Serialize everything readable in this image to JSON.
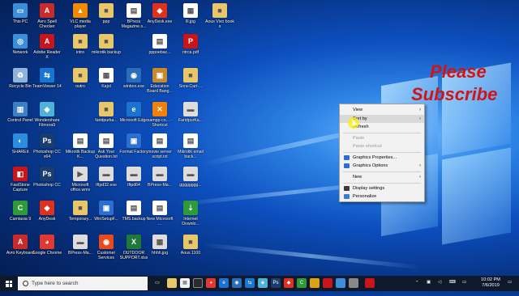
{
  "overlay": {
    "line1": "Please",
    "line2": "Subscribe"
  },
  "desktop": {
    "icons": [
      {
        "label": "This PC",
        "color": "#3a8fd8",
        "glyph": "▭"
      },
      {
        "label": "Avro Spell Checker",
        "color": "#c92b2b",
        "glyph": "A"
      },
      {
        "label": "VLC media player",
        "color": "#f08a00",
        "glyph": "▲"
      },
      {
        "label": "ppp",
        "color": "#e8c76a",
        "glyph": "■"
      },
      {
        "label": "BPress Magazine.s...",
        "color": "#ffffff",
        "glyph": "▤"
      },
      {
        "label": "AnyDesk.exe",
        "color": "#e0311f",
        "glyph": "◆"
      },
      {
        "label": "lll.jpg",
        "color": "#ffffff",
        "glyph": "▦"
      },
      {
        "label": "Aous Vivo book s",
        "color": "#e8c76a",
        "glyph": "■"
      },
      {
        "label": "Network",
        "color": "#3a8fd8",
        "glyph": "◎"
      },
      {
        "label": "Adobe Reader X",
        "color": "#c8151b",
        "glyph": "A"
      },
      {
        "label": "intro",
        "color": "#e8c76a",
        "glyph": "■"
      },
      {
        "label": "mikrotik backup",
        "color": "#e8c76a",
        "glyph": "■"
      },
      {
        "label": "",
        "color": "",
        "glyph": ""
      },
      {
        "label": "pppoebac...",
        "color": "#ffffff",
        "glyph": "▤"
      },
      {
        "label": "ntrca.pdf",
        "color": "#c8151b",
        "glyph": "P"
      },
      {
        "label": "",
        "color": "",
        "glyph": ""
      },
      {
        "label": "Recycle Bin",
        "color": "#8fb3d9",
        "glyph": "♻"
      },
      {
        "label": "TeamViewer 14",
        "color": "#1676d2",
        "glyph": "⇆"
      },
      {
        "label": "outro",
        "color": "#e8c76a",
        "glyph": "■"
      },
      {
        "label": "Kajol",
        "color": "#ffffff",
        "glyph": "▦"
      },
      {
        "label": "winbox.exe",
        "color": "#2a6db8",
        "glyph": "◉"
      },
      {
        "label": "Education Board Bang...",
        "color": "#c98a2d",
        "glyph": "▣"
      },
      {
        "label": "Sora-Cart-...",
        "color": "#e8c76a",
        "glyph": "■"
      },
      {
        "label": "",
        "color": "",
        "glyph": ""
      },
      {
        "label": "Control Panel",
        "color": "#3b7fc4",
        "glyph": "▥"
      },
      {
        "label": "Wondershare Filmora9",
        "color": "#4fb3d9",
        "glyph": "◈"
      },
      {
        "label": "",
        "color": "",
        "glyph": ""
      },
      {
        "label": "faridpurka...",
        "color": "#e8c76a",
        "glyph": "■"
      },
      {
        "label": "Microsoft Edge",
        "color": "#1a73d0",
        "glyph": "e"
      },
      {
        "label": "xampp-co... - Shortcut",
        "color": "#f2800a",
        "glyph": "✕"
      },
      {
        "label": "FaridpurKa...",
        "color": "#dddddd",
        "glyph": "▬"
      },
      {
        "label": "",
        "color": "",
        "glyph": ""
      },
      {
        "label": "SHAREit",
        "color": "#2b8de0",
        "glyph": "◐"
      },
      {
        "label": "Photoshop CC x64",
        "color": "#1a3c6e",
        "glyph": "Ps"
      },
      {
        "label": "Mikrotik Backup K...",
        "color": "#ffffff",
        "glyph": "▤"
      },
      {
        "label": "Ask Your Question.txt",
        "color": "#ffffff",
        "glyph": "▤"
      },
      {
        "label": "Format Factory",
        "color": "#2b6fd0",
        "glyph": "▣"
      },
      {
        "label": "movie server script.txt",
        "color": "#ffffff",
        "glyph": "▤"
      },
      {
        "label": "Mikrotik email back...",
        "color": "#ffffff",
        "glyph": "▤"
      },
      {
        "label": "",
        "color": "",
        "glyph": ""
      },
      {
        "label": "FastStone Capture",
        "color": "#c8151b",
        "glyph": "◧"
      },
      {
        "label": "Photoshop CC",
        "color": "#1a3c6e",
        "glyph": "Ps"
      },
      {
        "label": "Microsoft office.wmv",
        "color": "#dddddd",
        "glyph": "▶"
      },
      {
        "label": "tftpd32.exe",
        "color": "#dddddd",
        "glyph": "▬"
      },
      {
        "label": "tftpd64",
        "color": "#dddddd",
        "glyph": "▬"
      },
      {
        "label": "BPress-Ma...",
        "color": "#dddddd",
        "glyph": "▬"
      },
      {
        "label": "gggggggg...",
        "color": "#dddddd",
        "glyph": "▬"
      },
      {
        "label": "",
        "color": "",
        "glyph": ""
      },
      {
        "label": "Camtasia 9",
        "color": "#2e9a3a",
        "glyph": "C"
      },
      {
        "label": "AnyDesk",
        "color": "#e0311f",
        "glyph": "◆"
      },
      {
        "label": "Temporary...",
        "color": "#e8c76a",
        "glyph": "■"
      },
      {
        "label": "WinSetupF...",
        "color": "#2b6fd0",
        "glyph": "▣"
      },
      {
        "label": "TMS.backup",
        "color": "#ffffff",
        "glyph": "▤"
      },
      {
        "label": "New Microsoft ...",
        "color": "#ffffff",
        "glyph": "▤"
      },
      {
        "label": "Internet Downlo...",
        "color": "#2e9a3a",
        "glyph": "⇣"
      },
      {
        "label": "",
        "color": "",
        "glyph": ""
      },
      {
        "label": "Avro Keyboard",
        "color": "#c92b2b",
        "glyph": "A"
      },
      {
        "label": "Google Chrome",
        "color": "#e0392f",
        "glyph": "◕"
      },
      {
        "label": "BPress-Ma...",
        "color": "#dddddd",
        "glyph": "▬"
      },
      {
        "label": "Customer Services",
        "color": "#e84a1e",
        "glyph": "◉"
      },
      {
        "label": "OUTDOOR SUPPORT.xlsx",
        "color": "#1f7a3a",
        "glyph": "X"
      },
      {
        "label": "hhhh.jpg",
        "color": "#dddddd",
        "glyph": "▦"
      },
      {
        "label": "Aous 1100",
        "color": "#e8c76a",
        "glyph": "■"
      },
      {
        "label": "",
        "color": "",
        "glyph": ""
      }
    ]
  },
  "context_menu": {
    "view": "View",
    "sort_by": "Sort by",
    "refresh": "Refresh",
    "paste": "Paste",
    "paste_shortcut": "Paste shortcut",
    "graphics_properties": "Graphics Properties...",
    "graphics_options": "Graphics Options",
    "new": "New",
    "display_settings": "Display settings",
    "personalize": "Personalize"
  },
  "taskbar": {
    "search_placeholder": "Type here to search",
    "time": "10:02 PM",
    "date": "7/6/2019"
  },
  "colors": {
    "accent": "#0e1a2b",
    "overlay_text": "#d21414"
  }
}
